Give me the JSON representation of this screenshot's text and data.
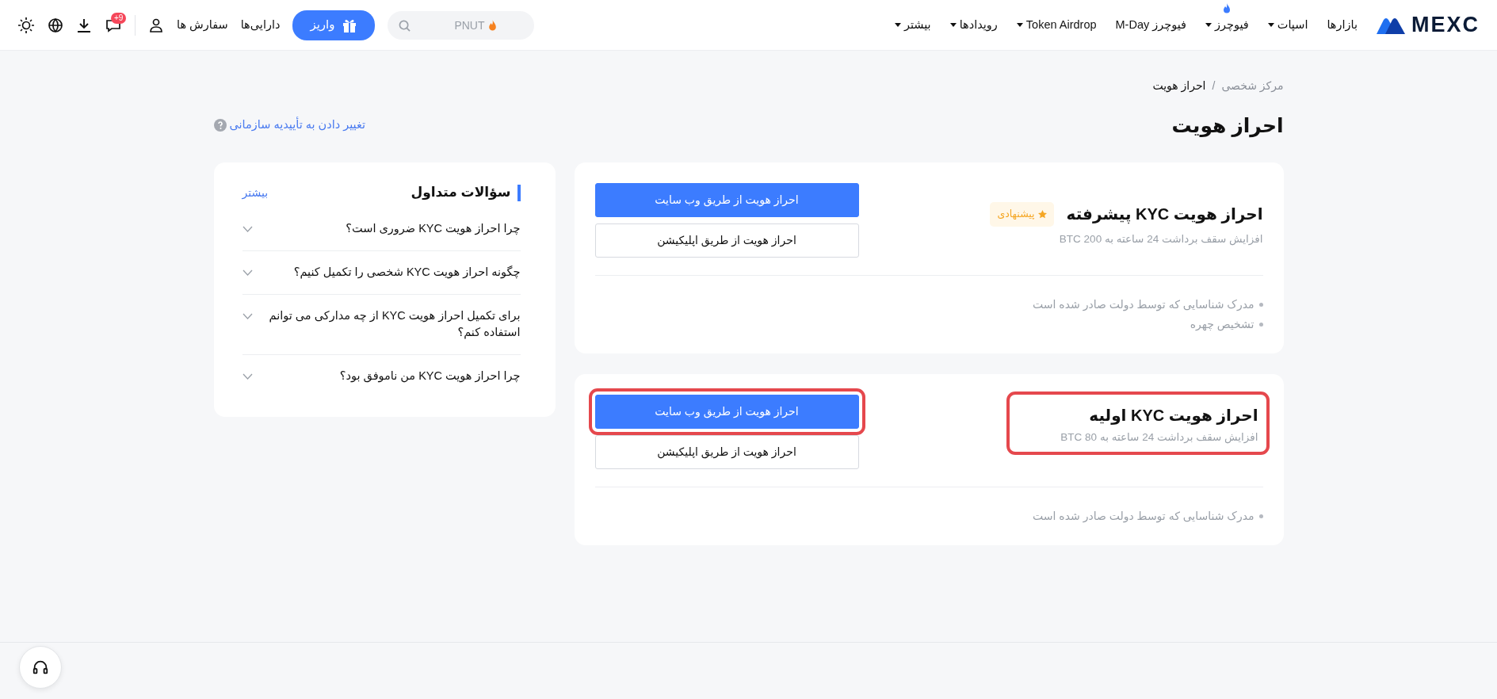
{
  "nav": {
    "logo": "MEXC",
    "menu": [
      {
        "label": "بازارها",
        "dropdown": false,
        "hot": false
      },
      {
        "label": "اسپات",
        "dropdown": true,
        "hot": false
      },
      {
        "label": "فیوچرز",
        "dropdown": true,
        "hot": true
      },
      {
        "label": "فیوچرز M-Day",
        "dropdown": false,
        "hot": false
      },
      {
        "label": "Token Airdrop",
        "dropdown": true,
        "hot": false
      },
      {
        "label": "رویدادها",
        "dropdown": true,
        "hot": false
      },
      {
        "label": "بیشتر",
        "dropdown": true,
        "hot": false
      }
    ],
    "search": {
      "placeholder": "PNUT"
    },
    "deposit": "واریز",
    "assets": "دارایی‌ها",
    "orders": "سفارش ها",
    "notifications": "+9"
  },
  "breadcrumb": [
    {
      "label": "مرکز شخصی",
      "selected": false
    },
    {
      "label": "احراز هویت",
      "selected": true
    }
  ],
  "breadcrumb_separator": "/",
  "title": "احراز هویت",
  "enterprise_link": "تغییر دادن به تأییدیه سازمانی",
  "levels": [
    {
      "title": "احراز هویت KYC پیشرفته",
      "badge": "پیشنهادی",
      "subtitle": "افزایش سقف برداشت 24 ساعته به 200 BTC",
      "highlighted": false,
      "buttons": [
        {
          "label": "احراز هویت از طریق وب سایت",
          "kind": "primary",
          "highlighted": false
        },
        {
          "label": "احراز هویت از طریق اپلیکیشن",
          "kind": "outline",
          "highlighted": false
        }
      ],
      "requirements": [
        "مدرک شناسایی که توسط دولت صادر شده است",
        "تشخیص چهره"
      ]
    },
    {
      "title": "احراز هویت KYC اولیه",
      "subtitle": "افزایش سقف برداشت 24 ساعته به 80 BTC",
      "highlighted": true,
      "buttons": [
        {
          "label": "احراز هویت از طریق وب سایت",
          "kind": "primary",
          "highlighted": true
        },
        {
          "label": "احراز هویت از طریق اپلیکیشن",
          "kind": "outline",
          "highlighted": false
        }
      ],
      "requirements": [
        "مدرک شناسایی که توسط دولت صادر شده است"
      ]
    }
  ],
  "faq": {
    "title": "سؤالات متداول",
    "more": "بیشتر",
    "items": [
      {
        "question": "چرا احراز هویت KYC ضروری است؟",
        "expanded": false
      },
      {
        "question": "چگونه احراز هویت KYC شخصی را تکمیل کنیم؟",
        "expanded": false
      },
      {
        "question": "برای تکمیل احراز هویت KYC از چه مدارکی می توانم استفاده کنم؟",
        "expanded": false
      },
      {
        "question": "چرا احراز هویت KYC من ناموفق بود؟",
        "expanded": false
      }
    ]
  }
}
